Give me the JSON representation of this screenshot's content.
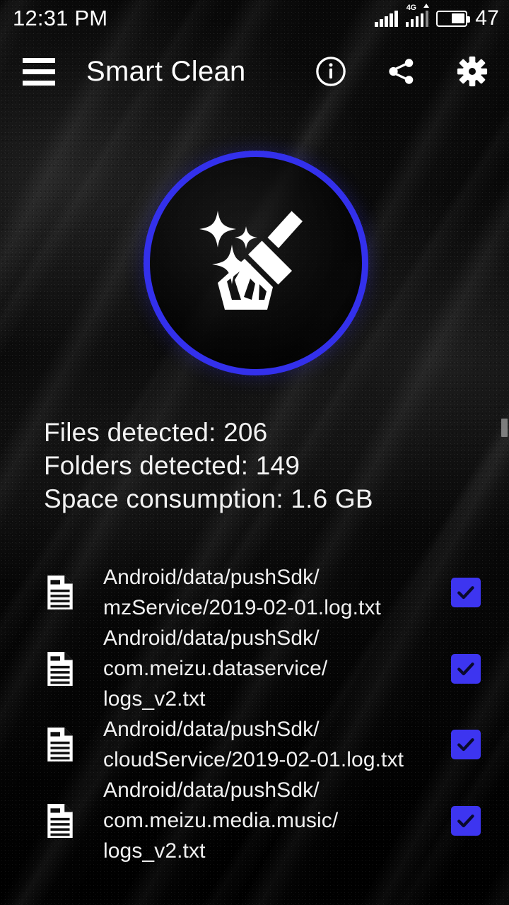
{
  "status_bar": {
    "clock": "12:31 PM",
    "battery_percent": "47",
    "network_label": "4G",
    "signal_icon": "signal-bars-icon",
    "battery_icon": "battery-icon"
  },
  "app_bar": {
    "menu_icon": "hamburger-menu-icon",
    "title": "Smart Clean",
    "actions": [
      {
        "name": "info-icon",
        "label": "Info"
      },
      {
        "name": "share-icon",
        "label": "Share"
      },
      {
        "name": "settings-gear-icon",
        "label": "Settings"
      }
    ]
  },
  "hero": {
    "icon": "broom-sparkle-icon",
    "ring_color": "#3330ec"
  },
  "stats": {
    "files_detected": "Files detected: 206",
    "folders_detected": "Folders detected: 149",
    "space_consumption": "Space consumption: 1.6 GB"
  },
  "theme": {
    "accent": "#3330ec",
    "checkbox": "#3d35f0",
    "text": "#f2f2f2",
    "background": "#050505"
  },
  "file_list": [
    {
      "icon": "document-file-icon",
      "path": "Android/data/pushSdk/\nmzService/2019-02-01.log.txt",
      "checked": true
    },
    {
      "icon": "document-file-icon",
      "path": "Android/data/pushSdk/\ncom.meizu.dataservice/\nlogs_v2.txt",
      "checked": true
    },
    {
      "icon": "document-file-icon",
      "path": "Android/data/pushSdk/\ncloudService/2019-02-01.log.txt",
      "checked": true
    },
    {
      "icon": "document-file-icon",
      "path": "Android/data/pushSdk/\ncom.meizu.media.music/\nlogs_v2.txt",
      "checked": true
    }
  ]
}
